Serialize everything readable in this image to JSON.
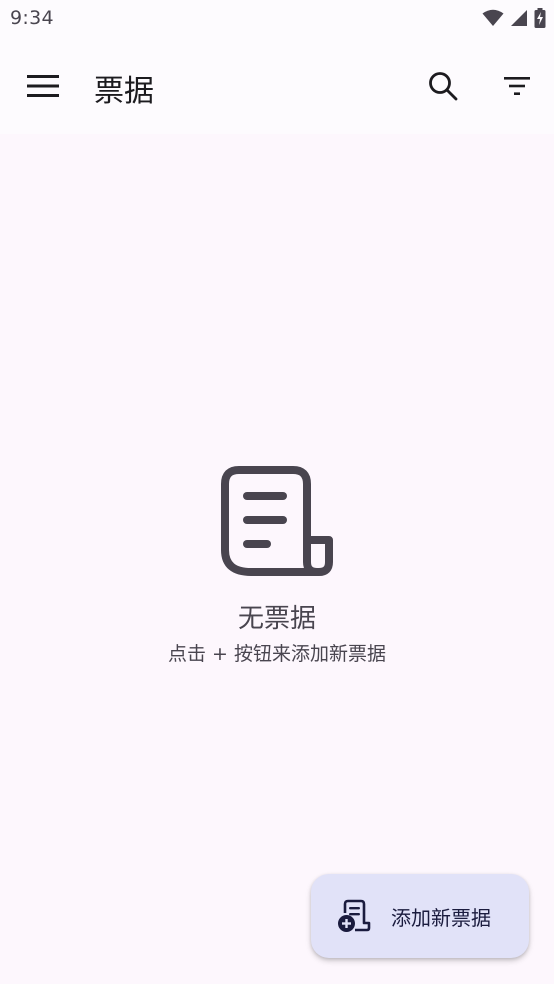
{
  "status_bar": {
    "time": "9:34",
    "icons": [
      "wifi-icon",
      "cellular-signal-icon",
      "battery-charging-icon"
    ]
  },
  "app_bar": {
    "title": "票据",
    "menu_icon": "menu-icon",
    "search_icon": "search-icon",
    "filter_icon": "filter-icon"
  },
  "empty_state": {
    "icon": "receipt-icon",
    "title": "无票据",
    "subtitle": "点击 + 按钮来添加新票据"
  },
  "fab": {
    "icon": "add-receipt-icon",
    "label": "添加新票据"
  },
  "colors": {
    "background": "#fdf7fd",
    "app_bar": "#fdfbfe",
    "fab_container": "#e1e2f8",
    "on_fab": "#1a1b3e",
    "icon_gray": "#49454f"
  }
}
